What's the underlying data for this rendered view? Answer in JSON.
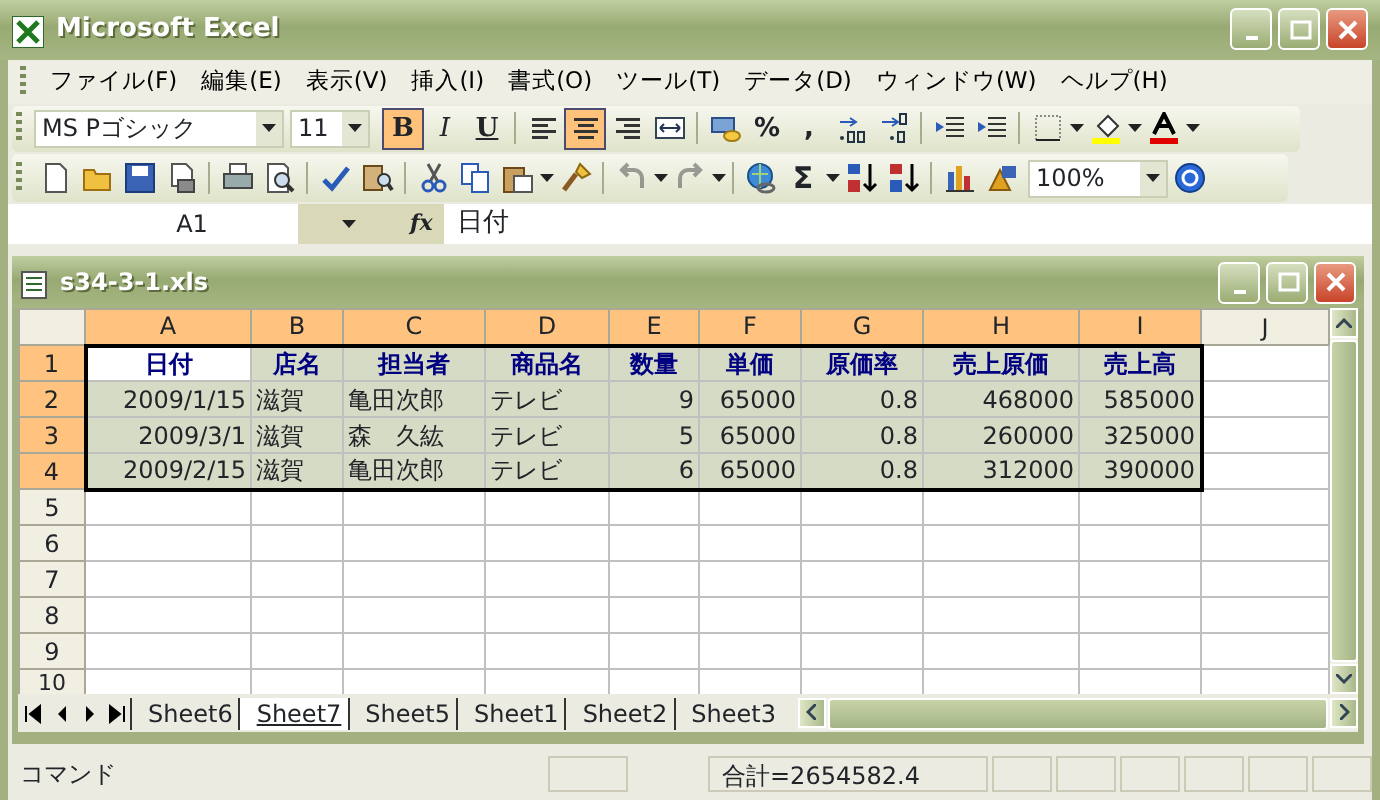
{
  "window": {
    "title": "Microsoft Excel"
  },
  "menu": [
    "ファイル(F)",
    "編集(E)",
    "表示(V)",
    "挿入(I)",
    "書式(O)",
    "ツール(T)",
    "データ(D)",
    "ウィンドウ(W)",
    "ヘルプ(H)"
  ],
  "formatting_toolbar": {
    "font": "MS Pゴシック",
    "size": "11",
    "items": [
      {
        "kind": "bold",
        "label": "B",
        "selected": true
      },
      {
        "kind": "italic",
        "label": "I",
        "selected": false
      },
      {
        "kind": "underline",
        "label": "U",
        "selected": false
      },
      {
        "kind": "separator"
      },
      {
        "kind": "align-left",
        "selected": false
      },
      {
        "kind": "align-center",
        "selected": true
      },
      {
        "kind": "align-right",
        "selected": false
      },
      {
        "kind": "merge",
        "selected": false
      },
      {
        "kind": "separator"
      },
      {
        "kind": "currency",
        "selected": false
      },
      {
        "kind": "char",
        "label": "%",
        "selected": false
      },
      {
        "kind": "char",
        "label": ",",
        "selected": false
      },
      {
        "kind": "increase-decimal",
        "selected": false
      },
      {
        "kind": "decrease-decimal",
        "selected": false
      },
      {
        "kind": "separator"
      },
      {
        "kind": "outdent",
        "selected": false
      },
      {
        "kind": "indent",
        "selected": false
      },
      {
        "kind": "separator"
      },
      {
        "kind": "borders",
        "selected": false
      },
      {
        "kind": "dropdown"
      },
      {
        "kind": "fill-color",
        "selected": false
      },
      {
        "kind": "dropdown"
      },
      {
        "kind": "font-color",
        "selected": false
      },
      {
        "kind": "dropdown"
      }
    ]
  },
  "standard_toolbar": {
    "zoom": "100%",
    "items": [
      {
        "kind": "new",
        "disabled": false
      },
      {
        "kind": "open",
        "disabled": false
      },
      {
        "kind": "save",
        "disabled": false
      },
      {
        "kind": "permission",
        "disabled": false
      },
      {
        "kind": "separator"
      },
      {
        "kind": "print",
        "disabled": false
      },
      {
        "kind": "preview",
        "disabled": false
      },
      {
        "kind": "separator"
      },
      {
        "kind": "spelling",
        "disabled": false
      },
      {
        "kind": "research",
        "disabled": false
      },
      {
        "kind": "separator"
      },
      {
        "kind": "cut",
        "disabled": false
      },
      {
        "kind": "copy",
        "disabled": false
      },
      {
        "kind": "paste",
        "disabled": false
      },
      {
        "kind": "dropdown"
      },
      {
        "kind": "format-painter",
        "disabled": false
      },
      {
        "kind": "separator"
      },
      {
        "kind": "undo",
        "disabled": true
      },
      {
        "kind": "dropdown"
      },
      {
        "kind": "redo",
        "disabled": true
      },
      {
        "kind": "dropdown"
      },
      {
        "kind": "separator"
      },
      {
        "kind": "hyperlink",
        "disabled": false
      },
      {
        "kind": "sum",
        "label": "Σ",
        "disabled": false
      },
      {
        "kind": "dropdown"
      },
      {
        "kind": "sort-ascending",
        "disabled": false
      },
      {
        "kind": "sort-descending",
        "disabled": false
      },
      {
        "kind": "separator"
      },
      {
        "kind": "chart",
        "disabled": false
      },
      {
        "kind": "drawing",
        "disabled": false
      },
      {
        "kind": "zoom"
      },
      {
        "kind": "help",
        "disabled": false
      }
    ]
  },
  "formula_bar": {
    "name_box": "A1",
    "function_label": "fx",
    "value": "日付"
  },
  "workbook": {
    "title": "s34-3-1.xls",
    "columns": [
      {
        "label": "A",
        "selected": true
      },
      {
        "label": "B",
        "selected": true
      },
      {
        "label": "C",
        "selected": true
      },
      {
        "label": "D",
        "selected": true
      },
      {
        "label": "E",
        "selected": true
      },
      {
        "label": "F",
        "selected": true
      },
      {
        "label": "G",
        "selected": true
      },
      {
        "label": "H",
        "selected": true
      },
      {
        "label": "I",
        "selected": true
      },
      {
        "label": "J",
        "selected": false
      }
    ],
    "rows": [
      {
        "header": "1",
        "selected": true,
        "cells": [
          {
            "text": "日付",
            "kind": "heading",
            "active": true
          },
          {
            "text": "店名",
            "kind": "heading",
            "active": false
          },
          {
            "text": "担当者",
            "kind": "heading",
            "active": false
          },
          {
            "text": "商品名",
            "kind": "heading",
            "active": false
          },
          {
            "text": "数量",
            "kind": "heading",
            "active": false
          },
          {
            "text": "単価",
            "kind": "heading",
            "active": false
          },
          {
            "text": "原価率",
            "kind": "heading",
            "active": false
          },
          {
            "text": "売上原価",
            "kind": "heading",
            "active": false
          },
          {
            "text": "売上高",
            "kind": "heading",
            "active": false
          }
        ]
      },
      {
        "header": "2",
        "selected": true,
        "cells": [
          {
            "text": "2009/1/15",
            "kind": "number",
            "active": false
          },
          {
            "text": "滋賀",
            "kind": "text",
            "active": false
          },
          {
            "text": "亀田次郎",
            "kind": "text",
            "active": false
          },
          {
            "text": "テレビ",
            "kind": "text",
            "active": false
          },
          {
            "text": "9",
            "kind": "number",
            "active": false
          },
          {
            "text": "65000",
            "kind": "number",
            "active": false
          },
          {
            "text": "0.8",
            "kind": "number",
            "active": false
          },
          {
            "text": "468000",
            "kind": "number",
            "active": false
          },
          {
            "text": "585000",
            "kind": "number",
            "active": false
          }
        ]
      },
      {
        "header": "3",
        "selected": true,
        "cells": [
          {
            "text": "2009/3/1",
            "kind": "number",
            "active": false
          },
          {
            "text": "滋賀",
            "kind": "text",
            "active": false
          },
          {
            "text": "森　久紘",
            "kind": "text",
            "active": false
          },
          {
            "text": "テレビ",
            "kind": "text",
            "active": false
          },
          {
            "text": "5",
            "kind": "number",
            "active": false
          },
          {
            "text": "65000",
            "kind": "number",
            "active": false
          },
          {
            "text": "0.8",
            "kind": "number",
            "active": false
          },
          {
            "text": "260000",
            "kind": "number",
            "active": false
          },
          {
            "text": "325000",
            "kind": "number",
            "active": false
          }
        ]
      },
      {
        "header": "4",
        "selected": true,
        "cells": [
          {
            "text": "2009/2/15",
            "kind": "number",
            "active": false
          },
          {
            "text": "滋賀",
            "kind": "text",
            "active": false
          },
          {
            "text": "亀田次郎",
            "kind": "text",
            "active": false
          },
          {
            "text": "テレビ",
            "kind": "text",
            "active": false
          },
          {
            "text": "6",
            "kind": "number",
            "active": false
          },
          {
            "text": "65000",
            "kind": "number",
            "active": false
          },
          {
            "text": "0.8",
            "kind": "number",
            "active": false
          },
          {
            "text": "312000",
            "kind": "number",
            "active": false
          },
          {
            "text": "390000",
            "kind": "number",
            "active": false
          }
        ]
      },
      {
        "header": "5",
        "selected": false
      },
      {
        "header": "6",
        "selected": false
      },
      {
        "header": "7",
        "selected": false
      },
      {
        "header": "8",
        "selected": false
      },
      {
        "header": "9",
        "selected": false
      },
      {
        "header": "10",
        "selected": false
      }
    ],
    "sheet_tabs": [
      {
        "label": "Sheet6",
        "selected": false
      },
      {
        "label": "Sheet7",
        "selected": true
      },
      {
        "label": "Sheet5",
        "selected": false
      },
      {
        "label": "Sheet1",
        "selected": false
      },
      {
        "label": "Sheet2",
        "selected": false
      },
      {
        "label": "Sheet3",
        "selected": false
      }
    ]
  },
  "status_bar": {
    "mode": "コマンド",
    "sum": "合計=2654582.4"
  }
}
